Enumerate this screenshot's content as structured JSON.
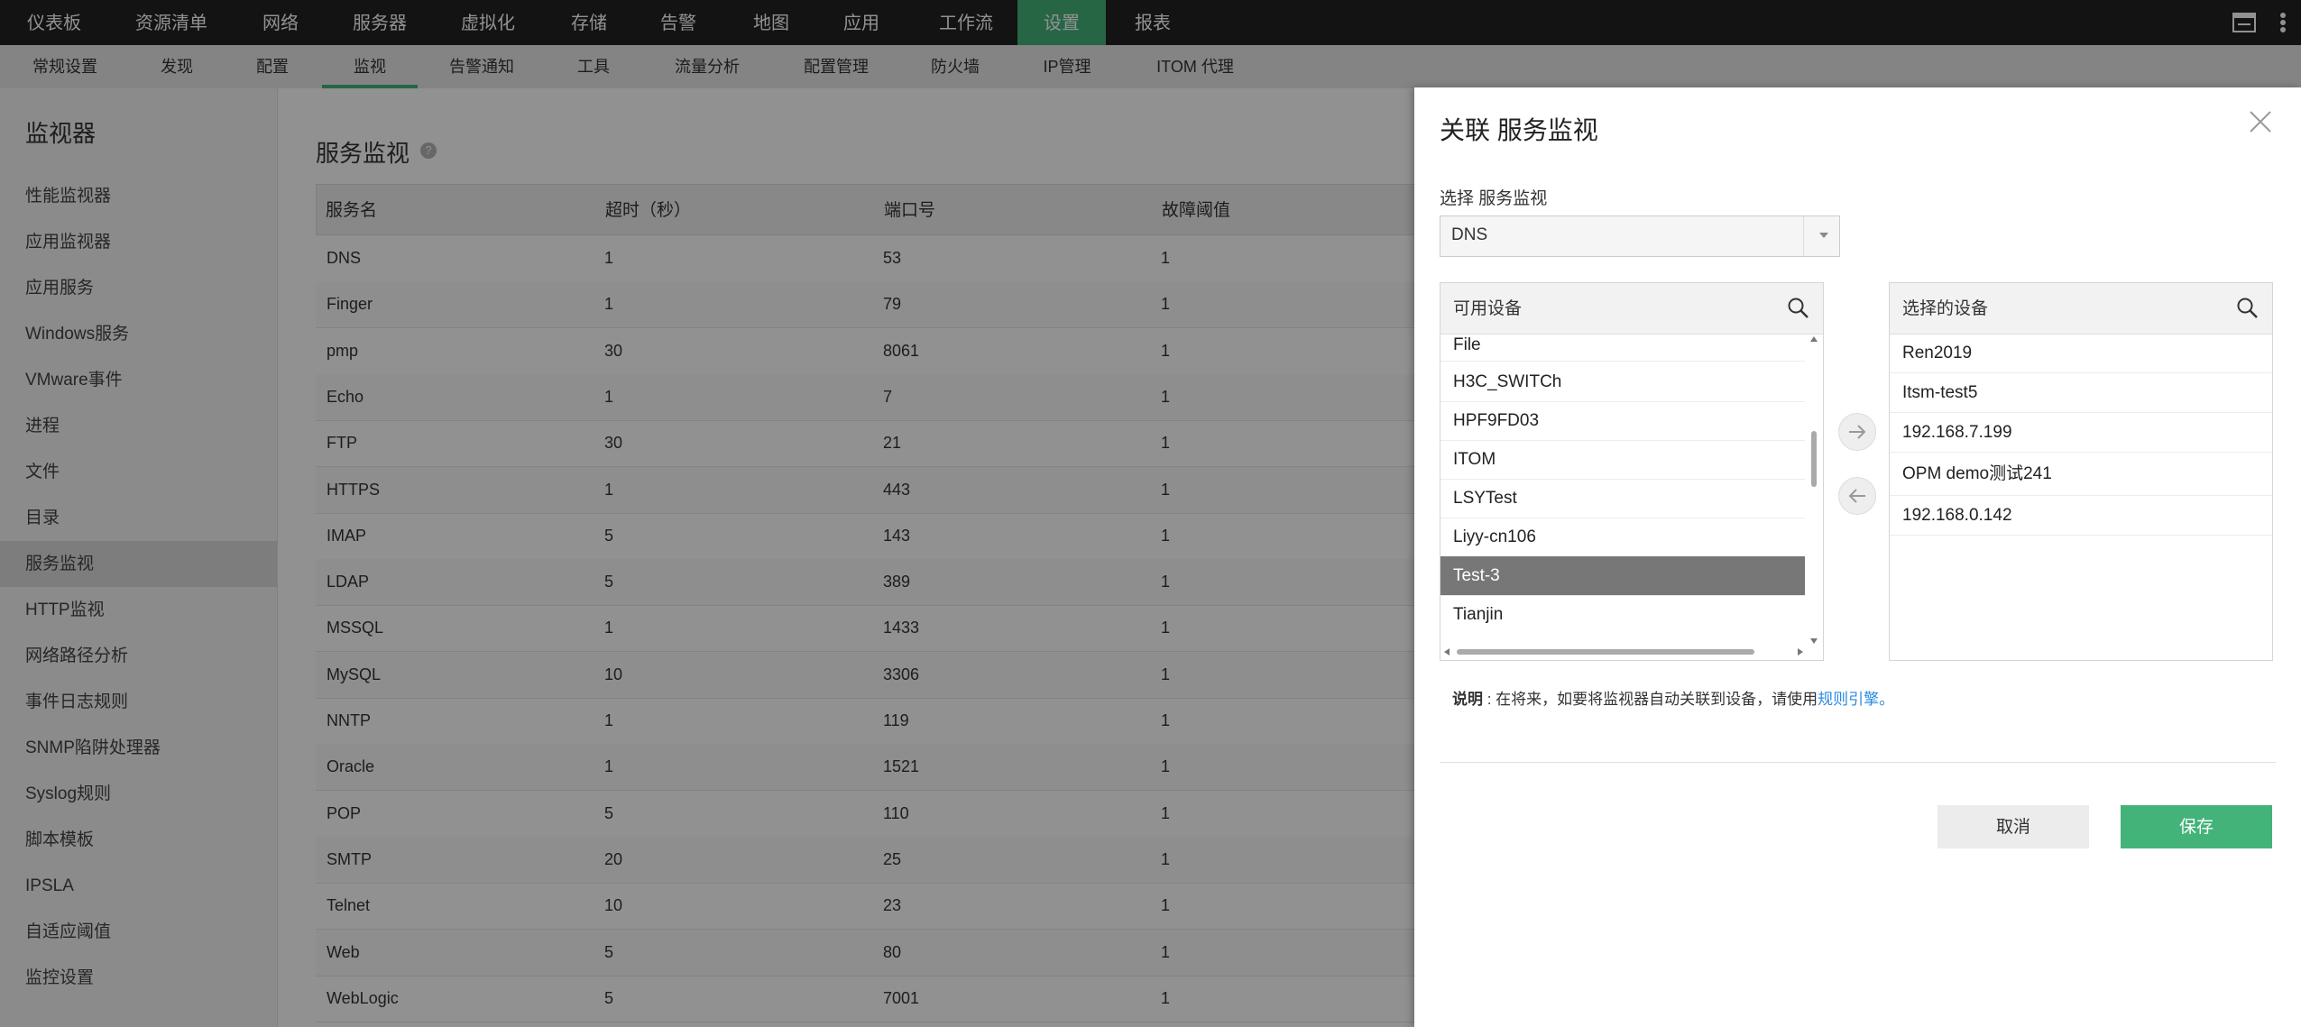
{
  "topnav": {
    "items": [
      "仪表板",
      "资源清单",
      "网络",
      "服务器",
      "虚拟化",
      "存储",
      "告警",
      "地图",
      "应用",
      "工作流",
      "设置",
      "报表"
    ],
    "active": "设置"
  },
  "subnav": {
    "items": [
      "常规设置",
      "发现",
      "配置",
      "监视",
      "告警通知",
      "工具",
      "流量分析",
      "配置管理",
      "防火墙",
      "IP管理",
      "ITOM 代理"
    ],
    "active": "监视"
  },
  "sidebar": {
    "title": "监视器",
    "items": [
      "性能监视器",
      "应用监视器",
      "应用服务",
      "Windows服务",
      "VMware事件",
      "进程",
      "文件",
      "目录",
      "服务监视",
      "HTTP监视",
      "网络路径分析",
      "事件日志规则",
      "SNMP陷阱处理器",
      "Syslog规则",
      "脚本模板",
      "IPSLA",
      "自适应阈值",
      "监控设置"
    ],
    "active": "服务监视"
  },
  "main": {
    "title": "服务监视",
    "help": "?",
    "table": {
      "columns": [
        "服务名",
        "超时（秒）",
        "端口号",
        "故障阈值"
      ],
      "rows": [
        [
          "DNS",
          "1",
          "53",
          "1"
        ],
        [
          "Finger",
          "1",
          "79",
          "1"
        ],
        [
          "pmp",
          "30",
          "8061",
          "1"
        ],
        [
          "Echo",
          "1",
          "7",
          "1"
        ],
        [
          "FTP",
          "30",
          "21",
          "1"
        ],
        [
          "HTTPS",
          "1",
          "443",
          "1"
        ],
        [
          "IMAP",
          "5",
          "143",
          "1"
        ],
        [
          "LDAP",
          "5",
          "389",
          "1"
        ],
        [
          "MSSQL",
          "1",
          "1433",
          "1"
        ],
        [
          "MySQL",
          "10",
          "3306",
          "1"
        ],
        [
          "NNTP",
          "1",
          "119",
          "1"
        ],
        [
          "Oracle",
          "1",
          "1521",
          "1"
        ],
        [
          "POP",
          "5",
          "110",
          "1"
        ],
        [
          "SMTP",
          "20",
          "25",
          "1"
        ],
        [
          "Telnet",
          "10",
          "23",
          "1"
        ],
        [
          "Web",
          "5",
          "80",
          "1"
        ],
        [
          "WebLogic",
          "5",
          "7001",
          "1"
        ]
      ]
    }
  },
  "panel": {
    "title": "关联 服务监视",
    "select_label": "选择 服务监视",
    "select_value": "DNS",
    "available": {
      "header": "可用设备",
      "items": [
        "File",
        "H3C_SWITCh",
        "HPF9FD03",
        "ITOM",
        "LSYTest",
        "Liyy-cn106",
        "Test-3",
        "Tianjin"
      ],
      "selected": "Test-3"
    },
    "chosen": {
      "header": "选择的设备",
      "items": [
        "Ren2019",
        "Itsm-test5",
        "192.168.7.199",
        "OPM demo测试241",
        "192.168.0.142"
      ]
    },
    "note": {
      "bold": "说明",
      "text": " : 在将来，如要将监视器自动关联到设备，请使用",
      "link": "规则引擎。"
    },
    "buttons": {
      "cancel": "取消",
      "save": "保存"
    }
  },
  "colors": {
    "accent": "#43b37a",
    "topbar": "#222222",
    "link": "#2a8ae0"
  }
}
